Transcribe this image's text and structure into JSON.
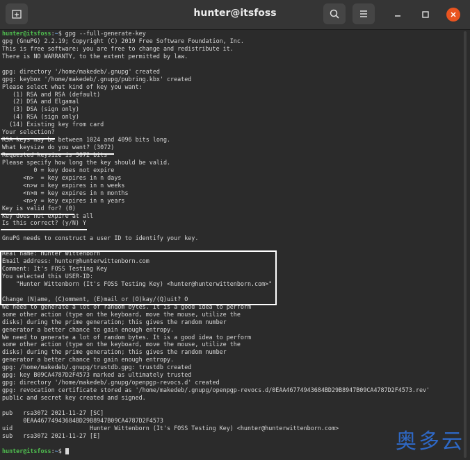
{
  "window": {
    "title": "hunter@itsfoss"
  },
  "prompt": {
    "user": "hunter@itsfoss",
    "path": "~",
    "symbol": "$ "
  },
  "lines": [
    {
      "type": "prompt",
      "cmd": "gpg --full-generate-key"
    },
    {
      "text": "gpg (GnuPG) 2.2.19; Copyright (C) 2019 Free Software Foundation, Inc."
    },
    {
      "text": "This is free software: you are free to change and redistribute it."
    },
    {
      "text": "There is NO WARRANTY, to the extent permitted by law."
    },
    {
      "text": ""
    },
    {
      "text": "gpg: directory '/home/makedeb/.gnupg' created"
    },
    {
      "text": "gpg: keybox '/home/makedeb/.gnupg/pubring.kbx' created"
    },
    {
      "text": "Please select what kind of key you want:"
    },
    {
      "text": "   (1) RSA and RSA (default)"
    },
    {
      "text": "   (2) DSA and Elgamal"
    },
    {
      "text": "   (3) DSA (sign only)"
    },
    {
      "text": "   (4) RSA (sign only)"
    },
    {
      "text": "  (14) Existing key from card"
    },
    {
      "text": "Your selection?"
    },
    {
      "text": "RSA keys may be between 1024 and 4096 bits long."
    },
    {
      "text": "What keysize do you want? (3072)"
    },
    {
      "text": "Requested keysize is 3072 bits"
    },
    {
      "text": "Please specify how long the key should be valid."
    },
    {
      "text": "         0 = key does not expire"
    },
    {
      "text": "      <n>  = key expires in n days"
    },
    {
      "text": "      <n>w = key expires in n weeks"
    },
    {
      "text": "      <n>m = key expires in n months"
    },
    {
      "text": "      <n>y = key expires in n years"
    },
    {
      "text": "Key is valid for? (0)"
    },
    {
      "text": "Key does not expire at all"
    },
    {
      "text": "Is this correct? (y/N) Y"
    },
    {
      "text": ""
    },
    {
      "text": "GnuPG needs to construct a user ID to identify your key."
    },
    {
      "text": ""
    },
    {
      "text": "Real name: Hunter Wittenborn"
    },
    {
      "text": "Email address: hunter@hunterwittenborn.com"
    },
    {
      "text": "Comment: It's FOSS Testing Key"
    },
    {
      "text": "You selected this USER-ID:"
    },
    {
      "text": "    \"Hunter Wittenborn (It's FOSS Testing Key) <hunter@hunterwittenborn.com>\""
    },
    {
      "text": ""
    },
    {
      "text": "Change (N)ame, (C)omment, (E)mail or (O)kay/(Q)uit? O"
    },
    {
      "text": "We need to generate a lot of random bytes. It is a good idea to perform"
    },
    {
      "text": "some other action (type on the keyboard, move the mouse, utilize the"
    },
    {
      "text": "disks) during the prime generation; this gives the random number"
    },
    {
      "text": "generator a better chance to gain enough entropy."
    },
    {
      "text": "We need to generate a lot of random bytes. It is a good idea to perform"
    },
    {
      "text": "some other action (type on the keyboard, move the mouse, utilize the"
    },
    {
      "text": "disks) during the prime generation; this gives the random number"
    },
    {
      "text": "generator a better chance to gain enough entropy."
    },
    {
      "text": "gpg: /home/makedeb/.gnupg/trustdb.gpg: trustdb created"
    },
    {
      "text": "gpg: key B09CA4787D2F4573 marked as ultimately trusted"
    },
    {
      "text": "gpg: directory '/home/makedeb/.gnupg/openpgp-revocs.d' created"
    },
    {
      "text": "gpg: revocation certificate stored as '/home/makedeb/.gnupg/openpgp-revocs.d/0EAA46774943684BD29B8947B09CA4787D2F4573.rev'"
    },
    {
      "text": "public and secret key created and signed."
    },
    {
      "text": ""
    },
    {
      "text": "pub   rsa3072 2021-11-27 [SC]"
    },
    {
      "text": "      0EAA46774943684BD29B8947B09CA4787D2F4573"
    },
    {
      "text": "uid                      Hunter Wittenborn (It's FOSS Testing Key) <hunter@hunterwittenborn.com>"
    },
    {
      "text": "sub   rsa3072 2021-11-27 [E]"
    },
    {
      "text": ""
    },
    {
      "type": "prompt",
      "cmd": ""
    }
  ],
  "watermark": "奥多云",
  "colors": {
    "user": "#4fbf4f",
    "path": "#6d9bd1",
    "text": "#d8d8d8",
    "close": "#e95420"
  },
  "icons": [
    "new-tab-icon",
    "search-icon",
    "menu-icon",
    "minimize-icon",
    "maximize-icon",
    "close-icon"
  ]
}
